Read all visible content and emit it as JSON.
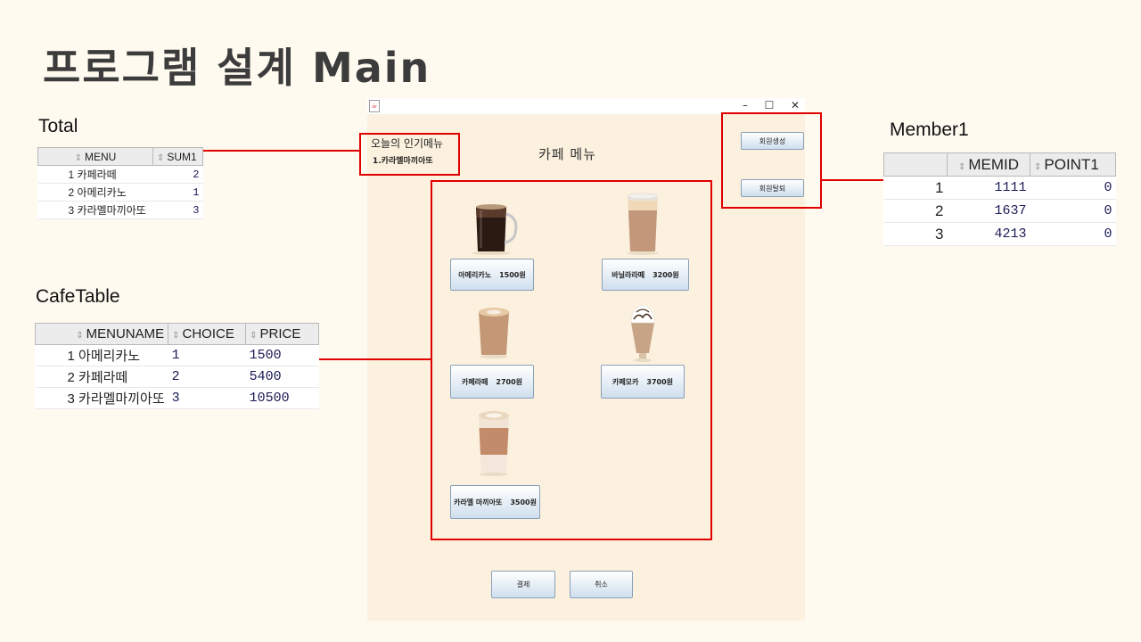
{
  "slide": {
    "title": "프로그램 설계 Main"
  },
  "total": {
    "label": "Total",
    "columns": [
      "MENU",
      "SUM1"
    ],
    "rows": [
      {
        "n": "1",
        "menu": "카페라떼",
        "sum": "2"
      },
      {
        "n": "2",
        "menu": "아메리카노",
        "sum": "1"
      },
      {
        "n": "3",
        "menu": "카라멜마끼아또",
        "sum": "3"
      }
    ]
  },
  "cafetable": {
    "label": "CafeTable",
    "columns": [
      "MENUNAME",
      "CHOICE",
      "PRICE"
    ],
    "rows": [
      {
        "n": "1",
        "name": "아메리카노",
        "choice": "1",
        "price": "1500"
      },
      {
        "n": "2",
        "name": "카페라떼",
        "choice": "2",
        "price": "5400"
      },
      {
        "n": "3",
        "name": "카라멜마끼아또",
        "choice": "3",
        "price": "10500"
      }
    ]
  },
  "member": {
    "label": "Member1",
    "columns": [
      "MEMID",
      "POINT1"
    ],
    "rows": [
      {
        "n": "1",
        "id": "1111",
        "point": "0"
      },
      {
        "n": "2",
        "id": "1637",
        "point": "0"
      },
      {
        "n": "3",
        "id": "4213",
        "point": "0"
      }
    ]
  },
  "app": {
    "window_controls": {
      "minimize": "–",
      "maximize": "☐",
      "close": "✕"
    },
    "popular": {
      "heading": "오늘의 인기메뉴",
      "item": "1.카라멜마끼아또"
    },
    "title": "카페 메뉴",
    "member_buttons": {
      "create": "회원생성",
      "withdraw": "회원탈퇴"
    },
    "menu": [
      {
        "name": "아메리카노",
        "price": "1500원"
      },
      {
        "name": "바닐라라떼",
        "price": "3200원"
      },
      {
        "name": "카페라떼",
        "price": "2700원"
      },
      {
        "name": "카페모카",
        "price": "3700원"
      },
      {
        "name": "카라멜 마끼아또",
        "price": "3500원"
      }
    ],
    "footer": {
      "pay": "결제",
      "cancel": "취소"
    }
  },
  "colors": {
    "highlight": "#e00000",
    "window_bg": "#fcf1de",
    "slide_bg": "#fffaf0"
  }
}
